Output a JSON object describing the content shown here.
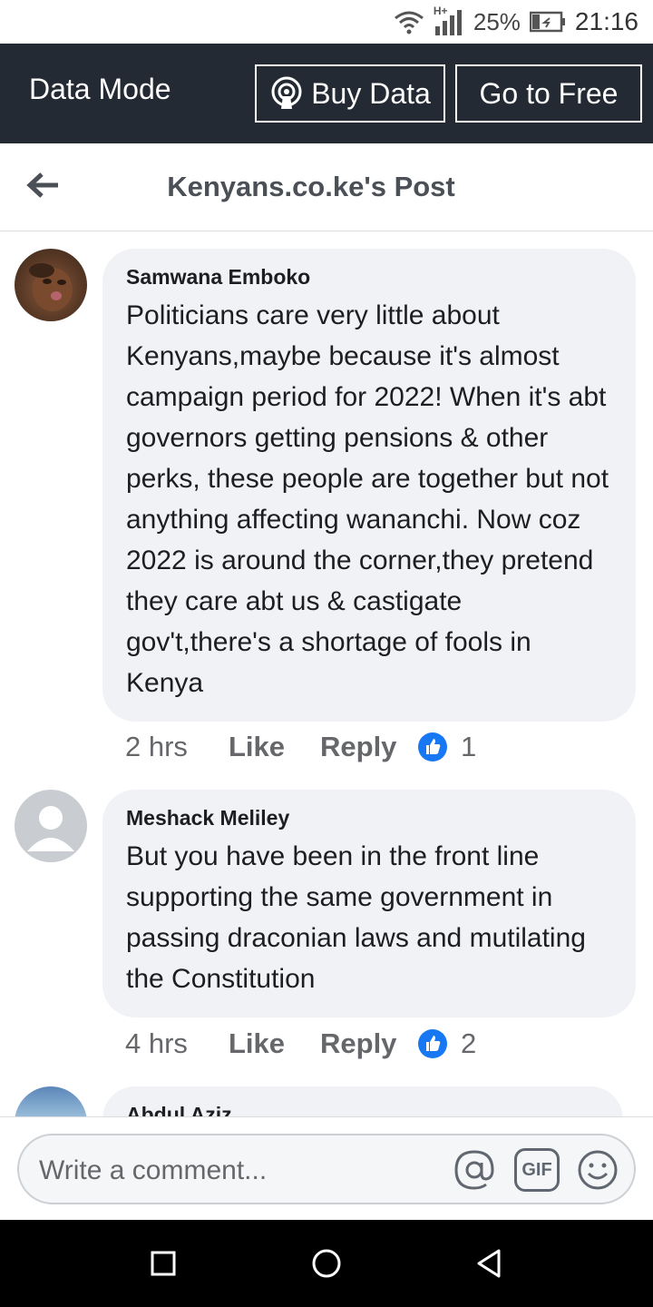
{
  "status_bar": {
    "network_label": "H+",
    "battery_percent": "25%",
    "time": "21:16"
  },
  "data_mode": {
    "label": "Data Mode",
    "buy_data_label": "Buy Data",
    "go_free_label": "Go to Free"
  },
  "header": {
    "title": "Kenyans.co.ke's Post"
  },
  "comments": [
    {
      "author": "Samwana Emboko",
      "text": "Politicians care very little about Kenyans,maybe because it's almost campaign period for 2022! When it's abt governors getting pensions & other perks, these people are together but not anything affecting wananchi. Now coz 2022 is around the corner,they pretend they care abt us & castigate gov't,there's a shortage of fools in Kenya",
      "time": "2 hrs",
      "like_label": "Like",
      "reply_label": "Reply",
      "like_count": "1"
    },
    {
      "author": "Meshack Meliley",
      "text": "But you have been in the front line supporting the same government in passing draconian laws and mutilating the Constitution",
      "time": "4 hrs",
      "like_label": "Like",
      "reply_label": "Reply",
      "like_count": "2"
    },
    {
      "author": "Abdul Aziz"
    }
  ],
  "composer": {
    "placeholder": "Write a comment...",
    "gif_label": "GIF"
  },
  "icons": {
    "wifi": "wifi-icon",
    "signal": "signal-icon",
    "battery": "battery-icon",
    "buy_data": "radio-broadcast-icon",
    "back": "arrow-left-icon",
    "like_badge": "thumbs-up-icon",
    "mention": "at-sign-icon",
    "gif": "gif-icon",
    "emoji": "smiley-icon",
    "nav_recents": "square-icon",
    "nav_home": "circle-icon",
    "nav_back": "triangle-back-icon"
  },
  "colors": {
    "data_mode_bg": "#232a34",
    "bubble_bg": "#f0f2f5",
    "like_blue": "#1877f2",
    "text_secondary": "#65676b"
  }
}
